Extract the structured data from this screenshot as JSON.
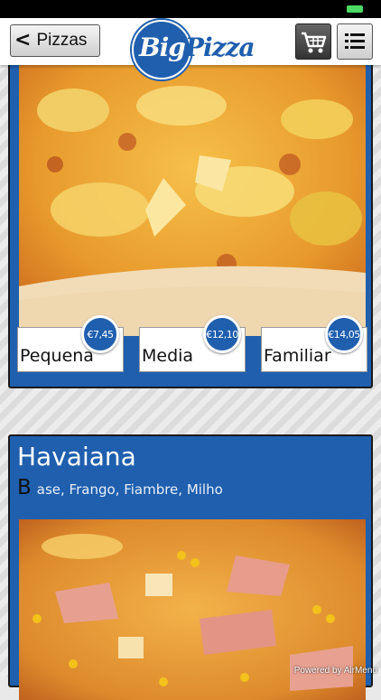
{
  "header": {
    "back_label": "Pizzas",
    "logo_text_1": "Big",
    "logo_text_2": "Pizza"
  },
  "items": [
    {
      "sizes": [
        {
          "label": "Pequena",
          "price": "€7,45"
        },
        {
          "label": "Media",
          "price": "€12,10"
        },
        {
          "label": "Familiar",
          "price": "€14,05"
        }
      ]
    },
    {
      "title": "Havaiana",
      "desc_initial": "B",
      "desc_rest": "ase, Frango, Fiambre, Milho"
    }
  ],
  "footer": {
    "powered_by": "Powered by AirMenu"
  },
  "colors": {
    "brand_blue": "#1f5fae",
    "status_green": "#4cd964"
  }
}
